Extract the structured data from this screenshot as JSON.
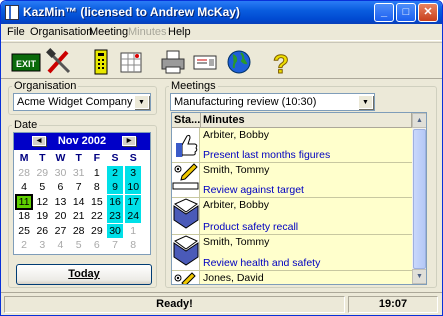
{
  "window": {
    "title": "KazMin™ (licensed to Andrew McKay)"
  },
  "menu": [
    "File",
    "Organisation",
    "Meeting",
    "Minutes",
    "Help"
  ],
  "toolbar": [
    "exit-icon",
    "tools-icon",
    "phone-icon",
    "calendar-icon",
    "printer-icon",
    "fax-icon",
    "globe-icon",
    "help-icon"
  ],
  "exit_label": "EXIT",
  "help_glyph": "?",
  "organisation": {
    "label": "Organisation",
    "value": "Acme Widget Company"
  },
  "date": {
    "label": "Date",
    "month": "Nov 2002",
    "dow": [
      "M",
      "T",
      "W",
      "T",
      "F",
      "S",
      "S"
    ],
    "weeks": [
      [
        "28",
        "29",
        "30",
        "31",
        "1",
        "2",
        "3"
      ],
      [
        "4",
        "5",
        "6",
        "7",
        "8",
        "9",
        "10"
      ],
      [
        "11",
        "12",
        "13",
        "14",
        "15",
        "16",
        "17"
      ],
      [
        "18",
        "19",
        "20",
        "21",
        "22",
        "23",
        "24"
      ],
      [
        "25",
        "26",
        "27",
        "28",
        "29",
        "30",
        "1"
      ],
      [
        "2",
        "3",
        "4",
        "5",
        "6",
        "7",
        "8"
      ]
    ],
    "today_button": "Today"
  },
  "meetings": {
    "label": "Meetings",
    "value": "Manufacturing review (10:30)"
  },
  "grid": {
    "columns": [
      "Sta...",
      "Minutes"
    ],
    "rows": [
      {
        "icon": "thumbs-up-icon",
        "name": "Arbiter, Bobby",
        "topic": "Present last months figures"
      },
      {
        "icon": "pencil-icon",
        "name": "Smith, Tommy",
        "topic": "Review against target"
      },
      {
        "icon": "book-icon",
        "name": "Arbiter, Bobby",
        "topic": "Product safety recall"
      },
      {
        "icon": "book-icon",
        "name": "Smith, Tommy",
        "topic": "Review health and safety"
      },
      {
        "icon": "pencil-icon",
        "name": "Jones, David",
        "topic": ""
      }
    ]
  },
  "status": {
    "text": "Ready!",
    "time": "19:07"
  }
}
